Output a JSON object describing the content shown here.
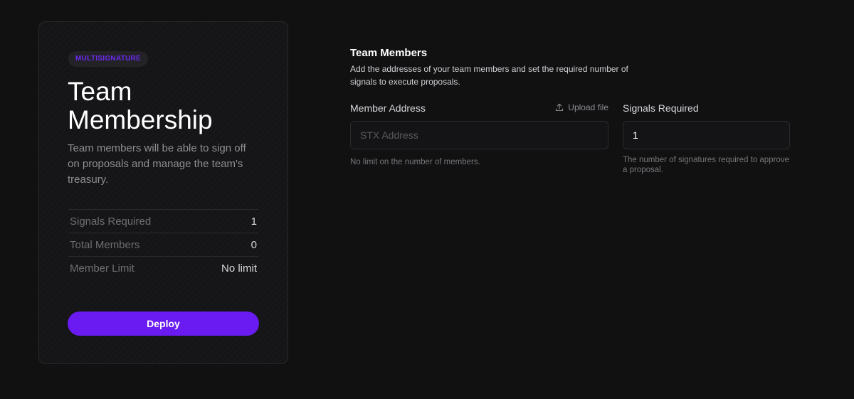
{
  "card": {
    "badge": "MULTISIGNATURE",
    "title": "Team Membership",
    "description": "Team members will be able to sign off on proposals and manage the team's treasury.",
    "stats": [
      {
        "label": "Signals Required",
        "value": "1"
      },
      {
        "label": "Total Members",
        "value": "0"
      },
      {
        "label": "Member Limit",
        "value": "No limit"
      }
    ],
    "deploy_label": "Deploy"
  },
  "section": {
    "title": "Team Members",
    "description": "Add the addresses of your team members and set the required number of signals to execute proposals."
  },
  "member_address": {
    "label": "Member Address",
    "upload_label": "Upload file",
    "value": "",
    "placeholder": "STX Address",
    "help": "No limit on the number of members."
  },
  "signals_required": {
    "label": "Signals Required",
    "value": "1",
    "placeholder": "",
    "help": "The number of signatures required to approve a proposal."
  },
  "colors": {
    "background": "#111112",
    "accent": "#6a1bf1",
    "badge_text": "#6d28f0"
  }
}
